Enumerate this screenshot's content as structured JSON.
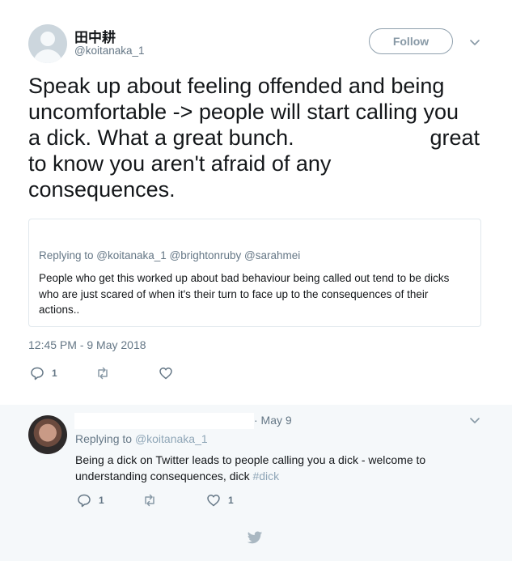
{
  "tweet": {
    "author_name": "田中耕",
    "author_handle": "@koitanaka_1",
    "follow_label": "Follow",
    "text_lines": [
      "Speak up about feeling offended and being",
      "uncomfortable -> people will start calling you",
      "a dick. What a great bunch.",
      "great",
      "to know you aren't afraid of any",
      "consequences."
    ],
    "quote": {
      "replying_to": "Replying to @koitanaka_1 @brightonruby @sarahmei",
      "text": "People who get this worked up about bad behaviour being called out tend to be dicks who are just scared of when it's their turn to face up to the consequences of their actions.."
    },
    "timestamp": "12:45 PM - 9 May 2018",
    "reply_count": "1"
  },
  "reply": {
    "date": "· May 9",
    "replying_prefix": "Replying to",
    "replying_mention": "@koitanaka_1",
    "text": "Being a dick on Twitter leads to people calling you a dick - welcome to understanding consequences, dick",
    "hashtag": "#dick",
    "reply_count": "1",
    "like_count": "1"
  },
  "icons": {
    "caret": "chevron-down-icon",
    "reply": "reply-icon",
    "retweet": "retweet-icon",
    "like": "heart-icon",
    "logo": "twitter-bird-icon"
  },
  "colors": {
    "secondary_text": "#657786",
    "border": "#e1e8ed",
    "reply_background": "#f5f8fa",
    "link_muted": "#8fa6b7"
  }
}
